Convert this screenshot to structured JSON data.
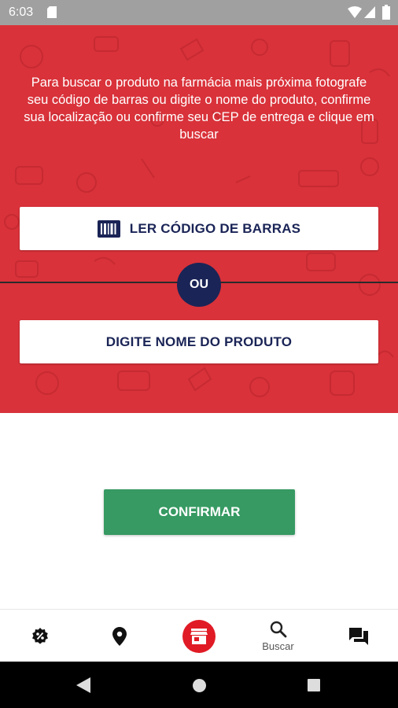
{
  "status_bar": {
    "time": "6:03"
  },
  "hero": {
    "instructions": "Para buscar o produto na farmácia mais próxima fotografe seu código de barras ou digite o nome do produto, confirme sua localização ou confirme seu CEP de entrega e clique em buscar",
    "barcode_button_label": "LER CÓDIGO DE BARRAS",
    "or_label": "OU",
    "product_name_button_label": "DIGITE NOME DO PRODUTO"
  },
  "confirm_button_label": "CONFIRMAR",
  "bottom_nav": {
    "items": [
      {
        "icon": "discount-icon",
        "label": ""
      },
      {
        "icon": "location-pin-icon",
        "label": ""
      },
      {
        "icon": "store-icon",
        "label": ""
      },
      {
        "icon": "search-icon",
        "label": "Buscar"
      },
      {
        "icon": "chat-icon",
        "label": ""
      }
    ]
  },
  "colors": {
    "hero_red": "#d9323a",
    "navy": "#1a2456",
    "confirm_green": "#369a62",
    "nav_store_red": "#e01b25"
  }
}
